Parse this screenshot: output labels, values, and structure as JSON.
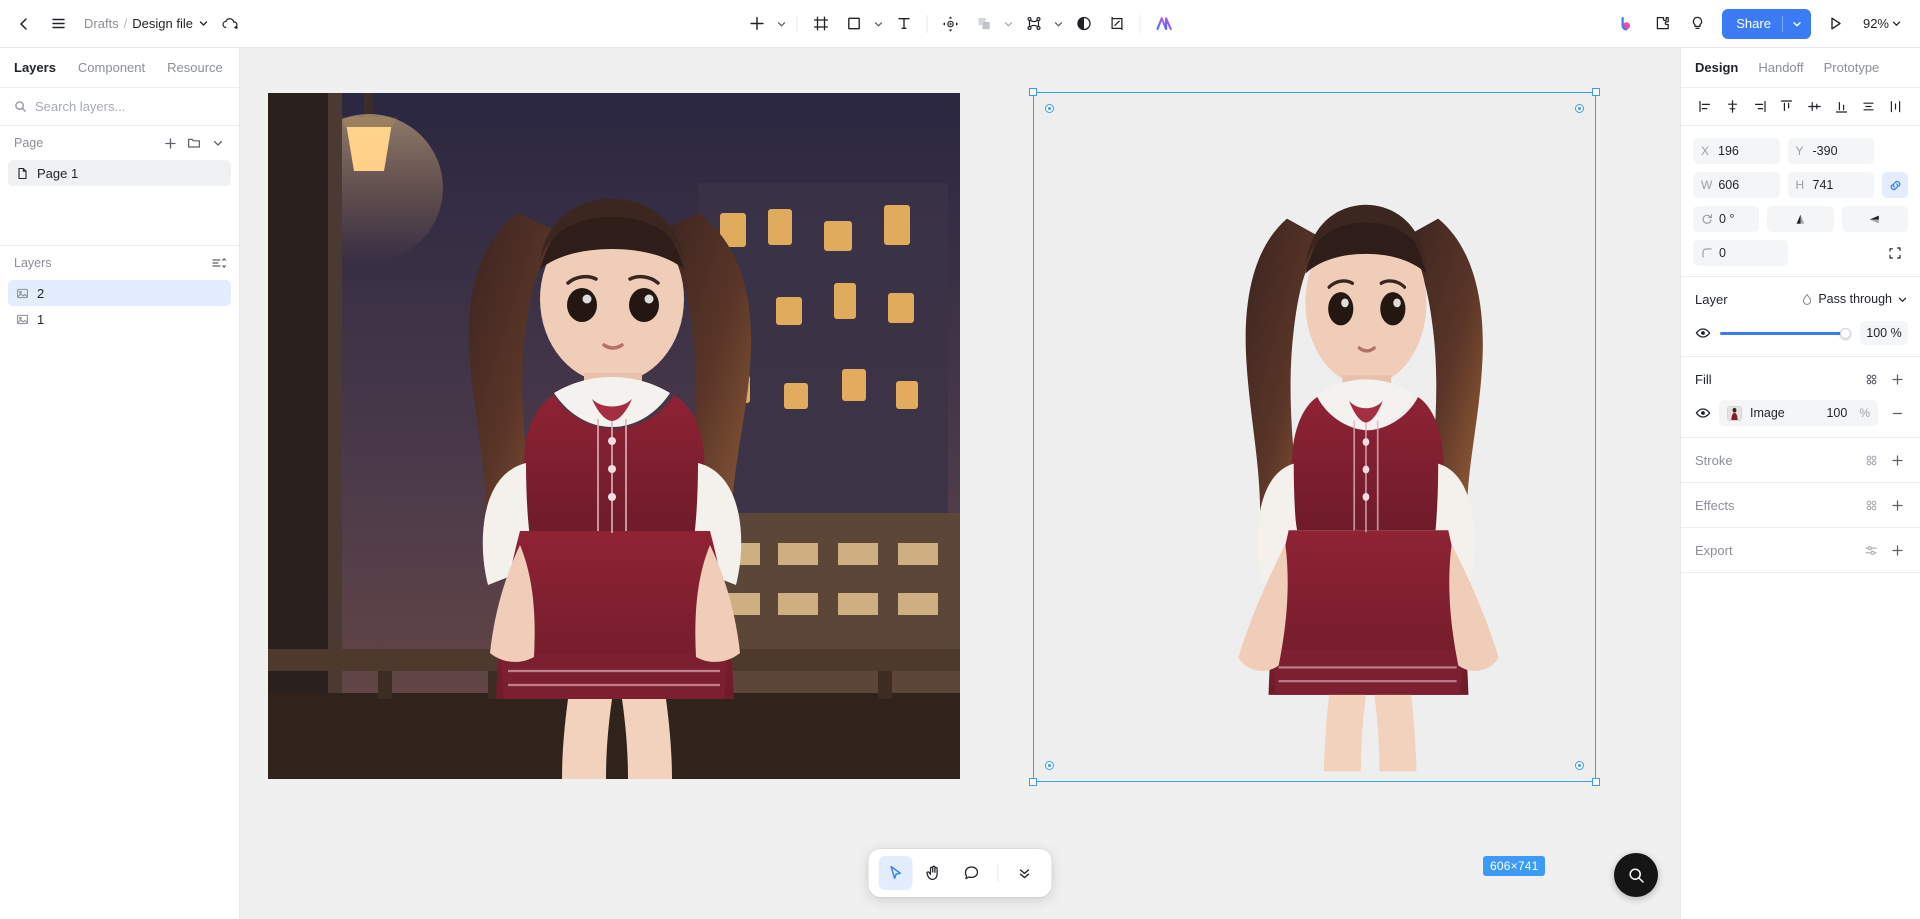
{
  "topbar": {
    "back_icon": "chevron-left-icon",
    "menu_icon": "hamburger-menu-icon",
    "breadcrumb": {
      "workspace": "Drafts",
      "separator": "/",
      "file": "Design file"
    },
    "cloud_icon": "cloud-saved-icon",
    "tools": [
      {
        "name": "add-tool",
        "icon": "plus-icon",
        "has_chevron": true
      },
      {
        "name": "frame-tool",
        "icon": "frame-icon",
        "has_chevron": false
      },
      {
        "name": "shape-tool",
        "icon": "rectangle-icon",
        "has_chevron": true
      },
      {
        "name": "text-tool",
        "icon": "text-t-icon",
        "has_chevron": false
      },
      {
        "name": "move-tool",
        "icon": "move-target-icon",
        "has_chevron": false
      },
      {
        "name": "boolean-tool",
        "icon": "boolean-union-icon",
        "has_chevron": true
      },
      {
        "name": "pen-tool",
        "icon": "vector-node-icon",
        "has_chevron": true
      },
      {
        "name": "mask-tool",
        "icon": "half-circle-icon",
        "has_chevron": false
      },
      {
        "name": "slice-tool",
        "icon": "crop-slice-icon",
        "has_chevron": false
      },
      {
        "name": "ai-tool",
        "icon": "ai-sparkle-icon",
        "has_chevron": false
      }
    ],
    "right": {
      "brand_icon": "b-logo-icon",
      "plugin_icon": "puzzle-piece-icon",
      "idea_icon": "lightbulb-icon",
      "share_label": "Share",
      "share_chevron_icon": "chevron-down-icon",
      "present_icon": "play-triangle-icon",
      "zoom_label": "92%",
      "zoom_chevron_icon": "chevron-down-icon",
      "share_color": "#3b7cf6"
    }
  },
  "left_panel": {
    "tabs": [
      {
        "label": "Layers",
        "active": true
      },
      {
        "label": "Component",
        "active": false
      },
      {
        "label": "Resource",
        "active": false
      }
    ],
    "search": {
      "placeholder": "Search layers...",
      "value": "",
      "icon": "search-icon"
    },
    "page_section": {
      "title": "Page",
      "add_icon": "plus-icon",
      "folder_icon": "folder-icon",
      "collapse_icon": "chevron-down-icon",
      "items": [
        {
          "label": "Page 1",
          "icon": "page-file-icon",
          "selected": true
        }
      ]
    },
    "layers_section": {
      "title": "Layers",
      "options_icon": "layer-options-icon",
      "items": [
        {
          "label": "2",
          "icon": "image-layer-icon",
          "selected": true
        },
        {
          "label": "1",
          "icon": "image-layer-icon",
          "selected": false
        }
      ]
    }
  },
  "canvas": {
    "selection_badge": "606×741",
    "selection_color": "#3b9bf6",
    "background": "#f0f0f0",
    "bottom_toolbar": [
      {
        "name": "select-tool",
        "icon": "cursor-arrow-icon",
        "active": true
      },
      {
        "name": "hand-tool",
        "icon": "hand-icon",
        "active": false
      },
      {
        "name": "comment-tool",
        "icon": "comment-bubble-icon",
        "active": false
      },
      {
        "name": "more-tools",
        "icon": "double-chevron-down-icon",
        "active": false
      }
    ],
    "fab": {
      "name": "zoom-search-button",
      "icon": "search-icon"
    }
  },
  "right_panel": {
    "tabs": [
      {
        "label": "Design",
        "active": true
      },
      {
        "label": "Handoff",
        "active": false
      },
      {
        "label": "Prototype",
        "active": false
      }
    ],
    "align_icons": [
      "align-left-icon",
      "align-horizontal-center-icon",
      "align-right-icon",
      "align-top-icon",
      "align-vertical-center-icon",
      "align-bottom-icon",
      "distribute-vertical-icon",
      "distribute-horizontal-icon"
    ],
    "transform": {
      "x_key": "X",
      "x_value": "196",
      "y_key": "Y",
      "y_value": "-390",
      "w_key": "W",
      "w_value": "606",
      "h_key": "H",
      "h_value": "741",
      "link_icon": "link-constrain-icon",
      "rotation_key": "rotation-icon",
      "rotation_value": "0 °",
      "flip_v_icon": "flip-vertical-icon",
      "flip_h_icon": "flip-horizontal-icon",
      "radius_key": "corner-radius-icon",
      "radius_value": "0",
      "independent_corners_icon": "independent-corners-icon"
    },
    "layer_section": {
      "title": "Layer",
      "blend_icon": "blend-mode-icon",
      "blend_mode": "Pass through",
      "blend_chevron_icon": "chevron-down-icon",
      "visibility_icon": "eye-icon",
      "opacity": "100 %",
      "opacity_percent": 100,
      "slider_color": "#3b7cf6"
    },
    "fill_section": {
      "title": "Fill",
      "styles_icon": "style-grid-icon",
      "add_icon": "plus-icon",
      "items": [
        {
          "visibility_icon": "eye-icon",
          "label": "Image",
          "opacity": "100",
          "unit": "%",
          "remove_icon": "minus-icon"
        }
      ]
    },
    "stroke_section": {
      "title": "Stroke",
      "styles_icon": "style-grid-icon",
      "add_icon": "plus-icon"
    },
    "effects_section": {
      "title": "Effects",
      "styles_icon": "style-grid-icon",
      "add_icon": "plus-icon"
    },
    "export_section": {
      "title": "Export",
      "settings_icon": "sliders-icon",
      "add_icon": "plus-icon"
    }
  }
}
